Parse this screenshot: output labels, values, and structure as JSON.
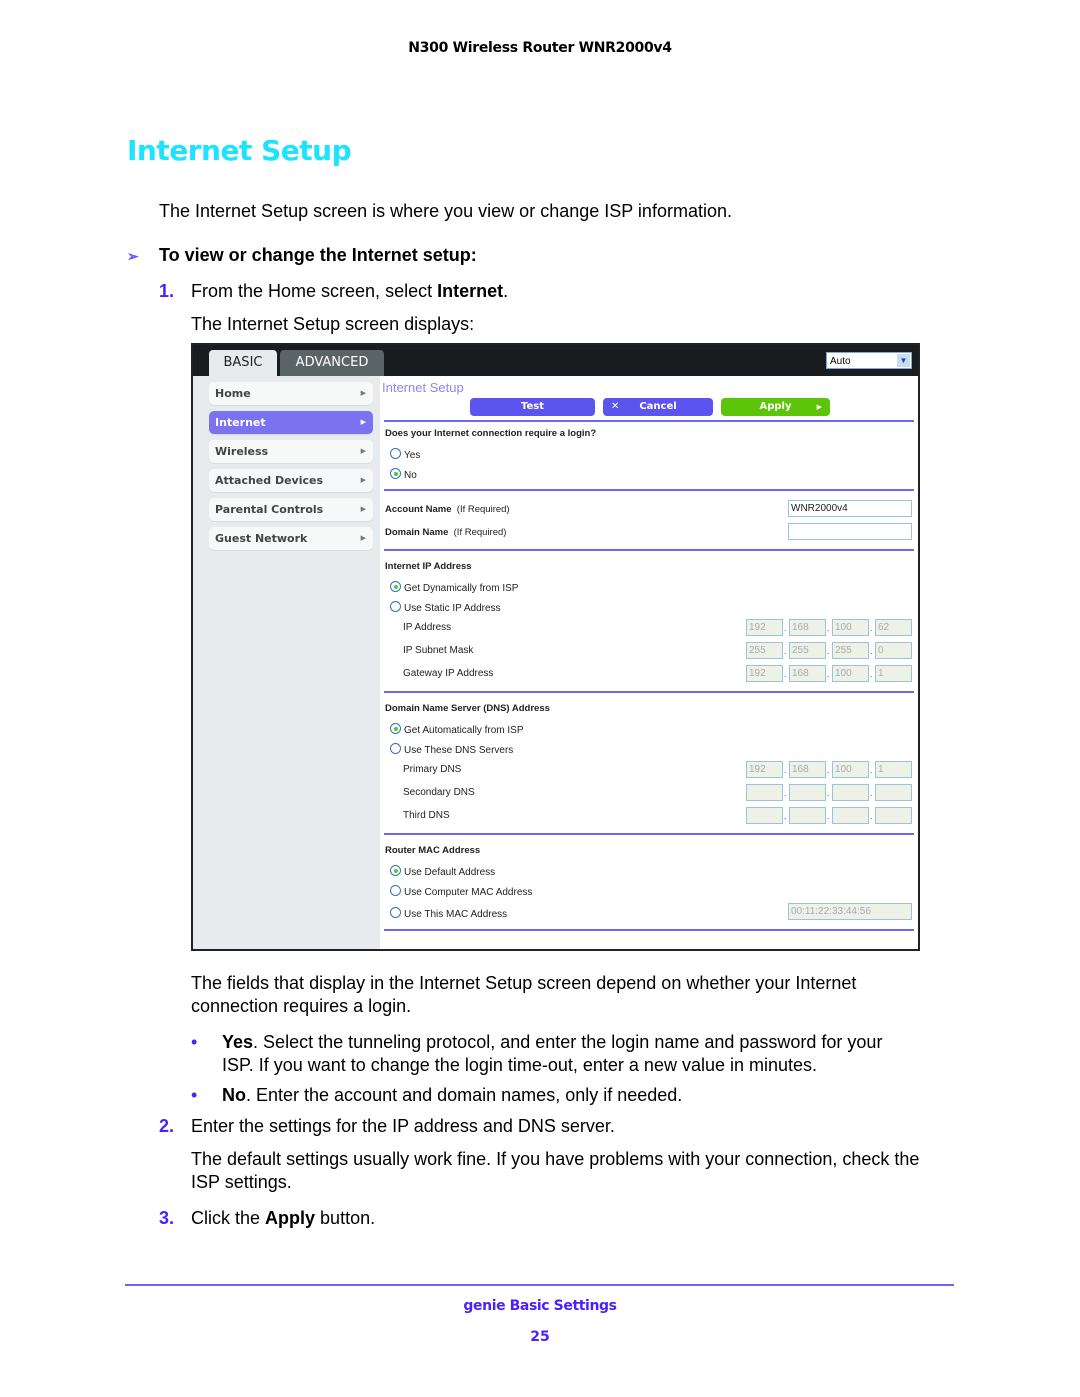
{
  "header": {
    "running_title": "N300 Wireless Router WNR2000v4"
  },
  "section_title": "Internet Setup",
  "intro": "The Internet Setup screen is where you view or change ISP information.",
  "procedure": {
    "arrow_icon": "➢",
    "heading": "To view or change the Internet setup:",
    "steps": [
      {
        "num": "1.",
        "text_before": "From the Home screen, select ",
        "bold": "Internet",
        "text_after": ".",
        "sub": "The Internet Setup screen displays:"
      },
      {
        "num": "2.",
        "text": "Enter the settings for the IP address and DNS server.",
        "sub": "The default settings usually work fine. If you have problems with your connection, check the ISP settings."
      },
      {
        "num": "3.",
        "text_before": "Click the ",
        "bold": "Apply",
        "text_after": " button."
      }
    ]
  },
  "fields_para": "The fields that display in the Internet Setup screen depend on whether your Internet connection requires a login.",
  "bullets": [
    {
      "dot": "•",
      "bold": "Yes",
      "line1": ". Select the tunneling protocol, and enter the login name and password for your",
      "line2": "ISP. If you want to change the login time-out, enter a new value in minutes."
    },
    {
      "dot": "•",
      "bold": "No",
      "line1": ". Enter the account and domain names, only if needed."
    }
  ],
  "router_ui": {
    "tabs": [
      "BASIC",
      "ADVANCED"
    ],
    "language_select": "Auto",
    "sidebar": [
      "Home",
      "Internet",
      "Wireless",
      "Attached Devices",
      "Parental Controls",
      "Guest Network"
    ],
    "active_item": "Internet",
    "page_title": "Internet Setup",
    "buttons": {
      "test": "Test",
      "cancel": "Cancel",
      "apply": "Apply"
    },
    "login_question": "Does your Internet connection require a login?",
    "login_options": [
      "Yes",
      "No"
    ],
    "login_selected": "No",
    "account_name_label": "Account Name",
    "domain_name_label": "Domain Name",
    "if_required": "(If Required)",
    "account_name_value": "WNR2000v4",
    "domain_name_value": "",
    "ip_section": "Internet IP Address",
    "ip_options": [
      "Get Dynamically from ISP",
      "Use Static IP Address"
    ],
    "ip_selected": "Get Dynamically from ISP",
    "ip_fields": [
      {
        "label": "IP Address",
        "octets": [
          "192",
          "168",
          "100",
          "62"
        ]
      },
      {
        "label": "IP Subnet Mask",
        "octets": [
          "255",
          "255",
          "255",
          "0"
        ]
      },
      {
        "label": "Gateway IP Address",
        "octets": [
          "192",
          "168",
          "100",
          "1"
        ]
      }
    ],
    "dns_section": "Domain Name Server (DNS) Address",
    "dns_options": [
      "Get Automatically from ISP",
      "Use These DNS Servers"
    ],
    "dns_selected": "Get Automatically from ISP",
    "dns_fields": [
      {
        "label": "Primary DNS",
        "octets": [
          "192",
          "168",
          "100",
          "1"
        ]
      },
      {
        "label": "Secondary DNS",
        "octets": [
          "",
          "",
          "",
          ""
        ]
      },
      {
        "label": "Third DNS",
        "octets": [
          "",
          "",
          "",
          ""
        ]
      }
    ],
    "mac_section": "Router MAC Address",
    "mac_options": [
      "Use Default Address",
      "Use Computer MAC Address",
      "Use This MAC Address"
    ],
    "mac_selected": "Use Default Address",
    "mac_value": "00:11:22:33:44:56"
  },
  "footer": {
    "section": "genie Basic Settings",
    "page": "25"
  },
  "colors": {
    "title": "#1ee3ff",
    "accent": "#4b1fff",
    "router_blue": "#5b54ee",
    "router_green": "#5ec40a"
  }
}
